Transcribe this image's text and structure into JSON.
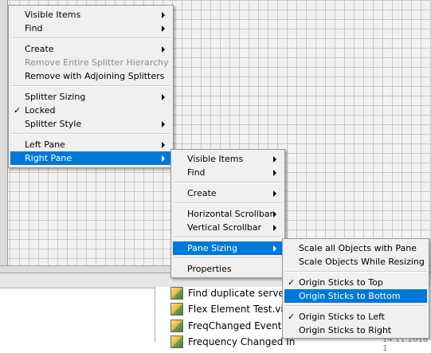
{
  "main_menu": {
    "items": [
      {
        "label": "Visible Items",
        "submenu": true
      },
      {
        "label": "Find",
        "submenu": true
      },
      {
        "label": "Create",
        "submenu": true
      },
      {
        "label": "Remove Entire Splitter Hierarchy",
        "disabled": true
      },
      {
        "label": "Adjoining Splitters",
        "prefix": "Remove with "
      },
      {
        "label": "Splitter Sizing",
        "submenu": true
      },
      {
        "label": "Locked",
        "checked": true
      },
      {
        "label": "Splitter Style",
        "submenu": true
      },
      {
        "label": "Left Pane",
        "submenu": true
      },
      {
        "label": "Right Pane",
        "submenu": true,
        "highlighted": true
      }
    ]
  },
  "right_pane_menu": {
    "items": [
      {
        "label": "Visible Items",
        "submenu": true
      },
      {
        "label": "Find",
        "submenu": true
      },
      {
        "label": "Create",
        "submenu": true
      },
      {
        "label": "Horizontal Scrollbar",
        "submenu": true
      },
      {
        "label": "Vertical Scrollbar",
        "submenu": true
      },
      {
        "label": "Pane Sizing",
        "submenu": true,
        "highlighted": true
      },
      {
        "label": "Properties"
      }
    ]
  },
  "pane_sizing_menu": {
    "items": [
      {
        "label": "Scale all Objects with Pane"
      },
      {
        "label": "Scale Objects While Resizing"
      },
      {
        "label": "Origin Sticks to Top",
        "checked": true
      },
      {
        "label": "Origin Sticks to Bottom",
        "highlighted": true
      },
      {
        "label": "Origin Sticks to Left",
        "checked": true
      },
      {
        "label": "Origin Sticks to Right"
      }
    ]
  },
  "file_list": {
    "items": [
      "Find duplicate server.vi",
      "Flex Element Test.vi",
      "FreqChanged Event Ca",
      "Frequency Changed In"
    ],
    "date": "14.11.2018 1"
  },
  "colors": {
    "highlight": "#0078d7",
    "menu_bg": "#f0f0f0",
    "disabled": "#8d8d8d"
  }
}
